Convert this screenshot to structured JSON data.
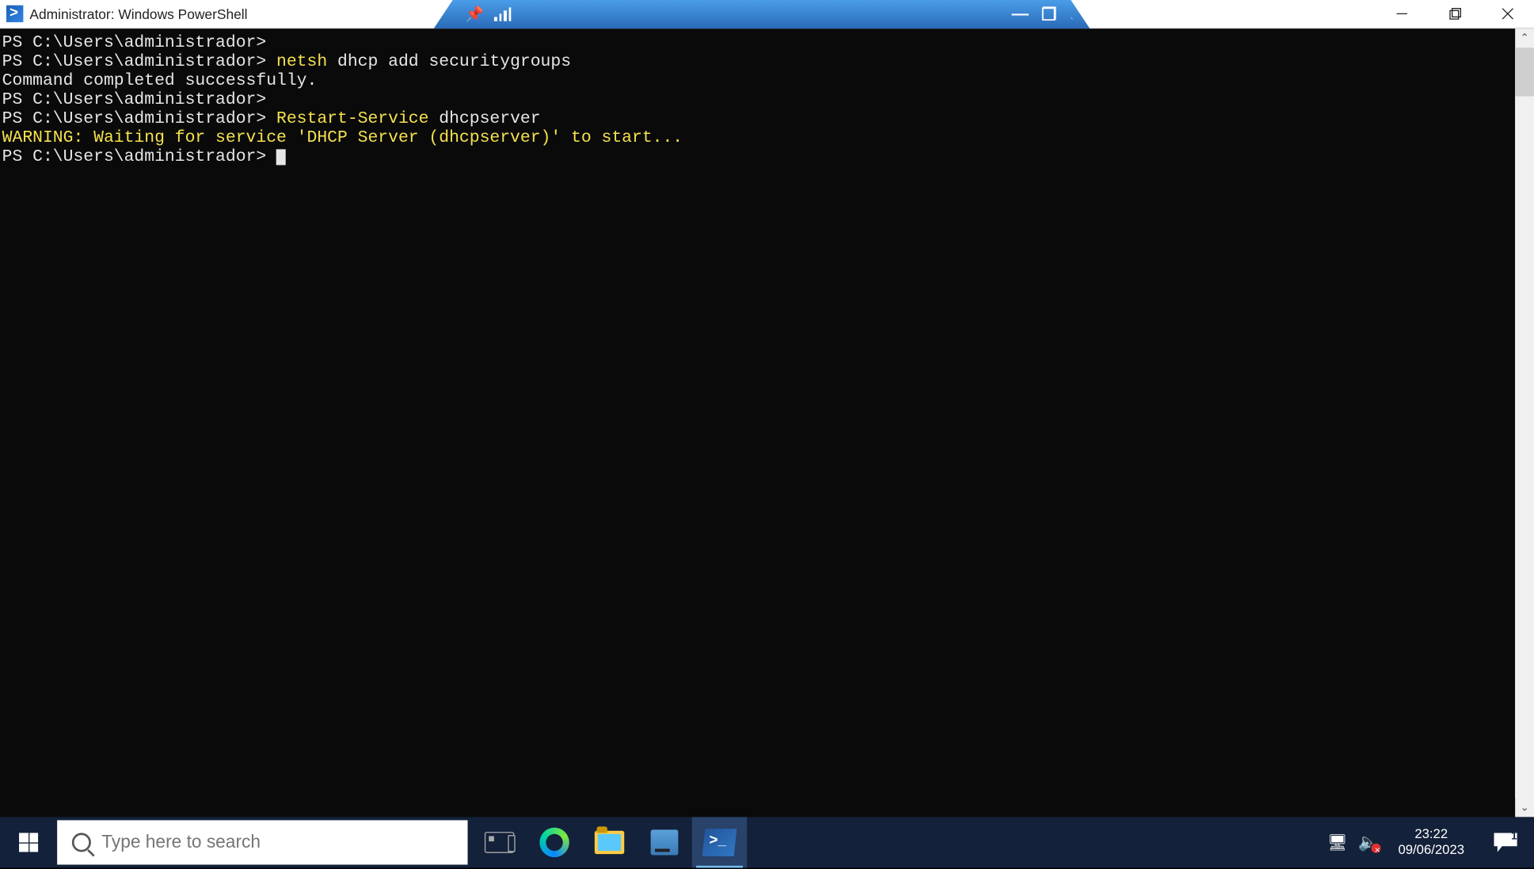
{
  "window": {
    "title": "Administrator: Windows PowerShell"
  },
  "remote_bar": {
    "pin": "⊣",
    "signal": "⊪",
    "minimize": "—",
    "restore": "❐",
    "close": "✕"
  },
  "win_controls": {
    "minimize": "—",
    "maximize": "☐",
    "close": "✕"
  },
  "terminal": {
    "lines": [
      {
        "prompt": "PS C:\\Users\\administrador> ",
        "cmd": ""
      },
      {
        "prompt": "PS C:\\Users\\administrador> ",
        "cmd_pre": "netsh ",
        "cmd_plain": "dhcp add securitygroups"
      },
      {
        "plain": ""
      },
      {
        "plain": "Command completed successfully."
      },
      {
        "prompt": "PS C:\\Users\\administrador> ",
        "cmd": ""
      },
      {
        "prompt": "PS C:\\Users\\administrador> ",
        "cmd_hl": "Restart-Service ",
        "cmd_plain": "dhcpserver"
      },
      {
        "warn": "WARNING: Waiting for service 'DHCP Server (dhcpserver)' to start..."
      },
      {
        "prompt": "PS C:\\Users\\administrador> ",
        "cursor": true
      }
    ]
  },
  "taskbar": {
    "search_placeholder": "Type here to search",
    "tray": {
      "time": "23:22",
      "date": "09/06/2023",
      "notif_count": "1"
    }
  },
  "scrollbar": {
    "up": "⌃",
    "down": "⌄"
  }
}
